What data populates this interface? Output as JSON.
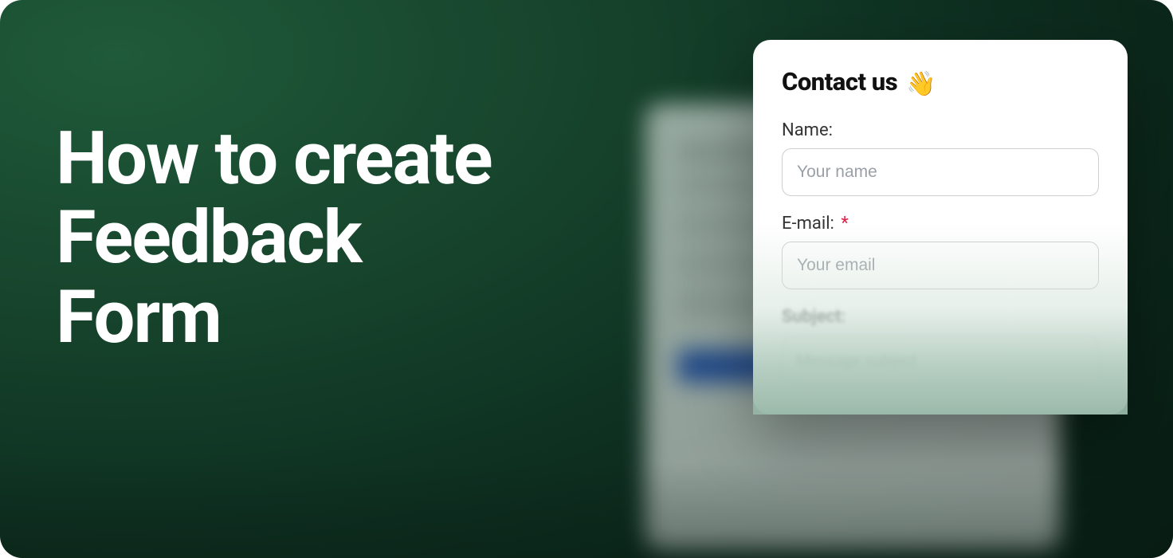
{
  "hero": {
    "title_line1": "How to create",
    "title_line2": "Feedback",
    "title_line3": "Form"
  },
  "card": {
    "title": "Contact us",
    "wave_emoji": "👋",
    "fields": {
      "name": {
        "label": "Name:",
        "placeholder": "Your name"
      },
      "email": {
        "label": "E-mail:",
        "required_mark": "*",
        "placeholder": "Your email"
      },
      "subject": {
        "label": "Subject:",
        "placeholder": "Message subject"
      }
    }
  }
}
